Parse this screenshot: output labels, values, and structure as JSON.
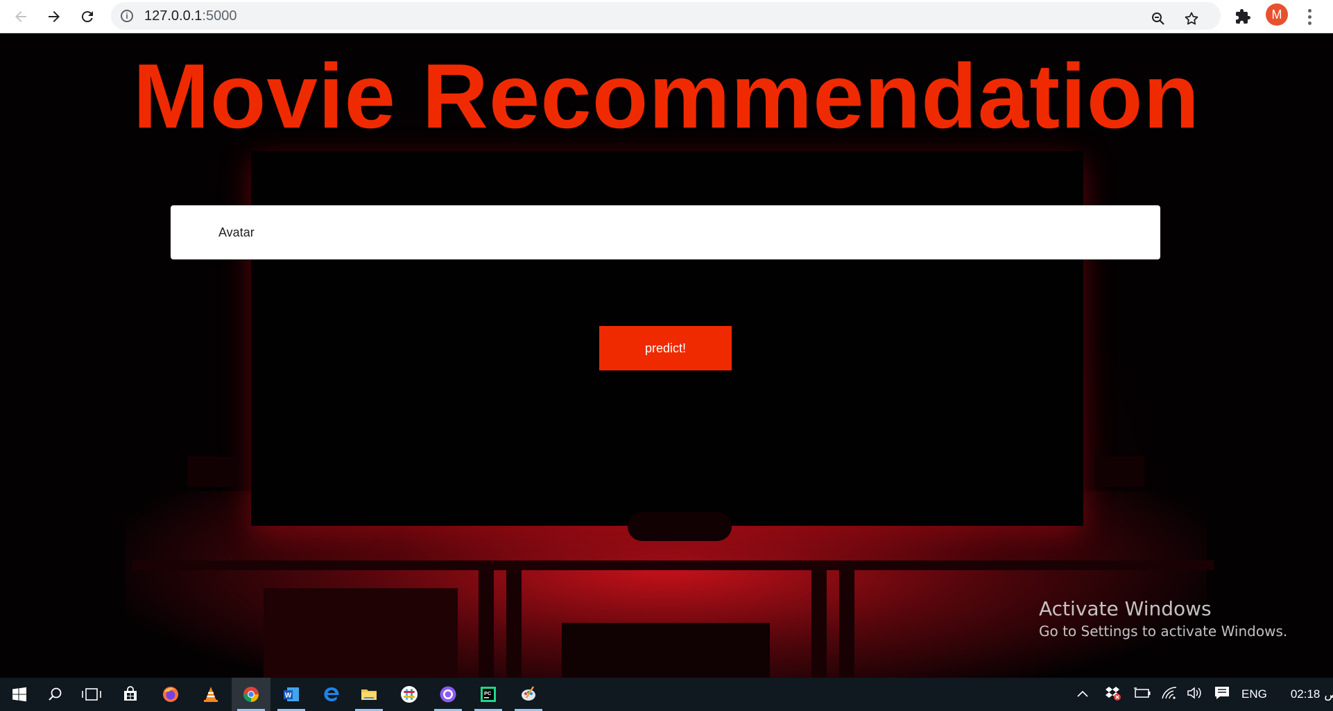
{
  "browser": {
    "url_host": "127.0.0.1",
    "url_port": ":5000",
    "profile_initial": "M",
    "icons": [
      "back-arrow-icon",
      "forward-arrow-icon",
      "reload-icon",
      "site-info-icon",
      "zoom-icon",
      "bookmark-star-icon",
      "extensions-puzzle-icon",
      "more-vertical-icon"
    ]
  },
  "page": {
    "title": "Movie Recommendation",
    "movie_input_value": "Avatar",
    "predict_label": "predict!",
    "accent_color": "#f02a00"
  },
  "watermark": {
    "title": "Activate Windows",
    "subtitle": "Go to Settings to activate Windows."
  },
  "taskbar": {
    "apps": [
      "start-windows-icon",
      "search-icon",
      "task-view-icon",
      "store-icon",
      "firefox-icon",
      "vlc-icon",
      "chrome-icon",
      "word-icon",
      "edge-icon",
      "file-explorer-icon",
      "slack-icon",
      "github-icon",
      "pycharm-icon",
      "paint-icon"
    ],
    "tray": {
      "language": "ENG",
      "time": "02:18",
      "ampm": "ص"
    }
  }
}
